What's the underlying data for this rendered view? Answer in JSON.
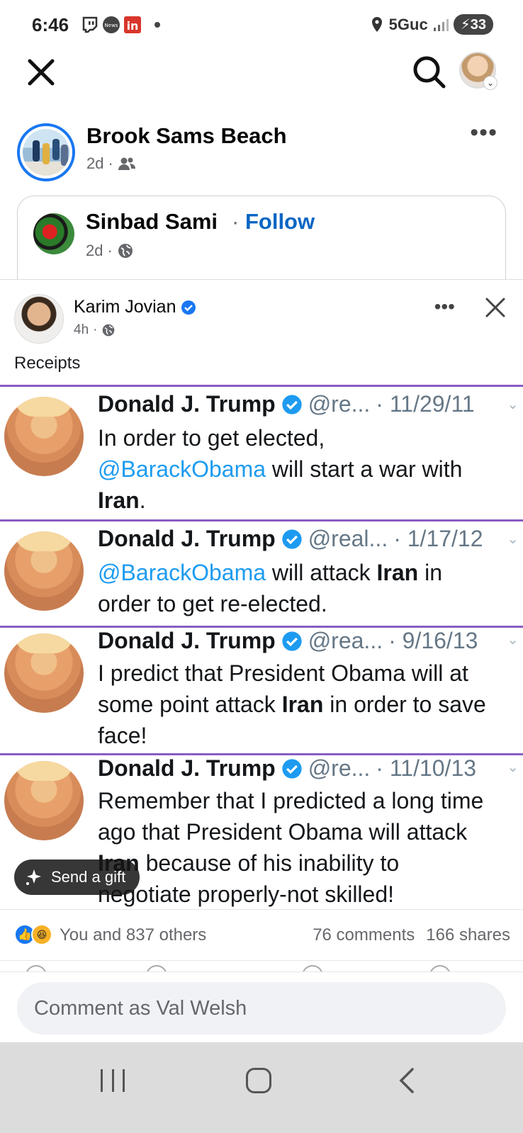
{
  "status_bar": {
    "time": "6:46",
    "network": "5Guc",
    "battery": "33"
  },
  "topbar": {
    "close_icon": "close-icon",
    "search_icon": "search-icon"
  },
  "post": {
    "author": "Brook Sams Beach",
    "time": "2d",
    "audience_separator": "·",
    "more": "•••"
  },
  "shared": {
    "author": "Sinbad Sami",
    "follow_separator": "·",
    "follow_label": "Follow",
    "time": "2d",
    "separator": "·"
  },
  "inner_post": {
    "author": "Karim Jovian",
    "time": "4h",
    "separator": "·",
    "more": "•••",
    "caption": "Receipts"
  },
  "tweets": [
    {
      "name": "Donald J. Trump",
      "handle": "@re...",
      "date": "· 11/29/11",
      "text_plain_1": "In order to get elected,",
      "mention": "@BarackObama",
      "text_plain_2": " will start a war with",
      "bold_word": "Iran",
      "text_plain_3": "."
    },
    {
      "name": "Donald J. Trump",
      "handle": "@real...",
      "date": "· 1/17/12",
      "mention": "@BarackObama",
      "text_plain_1": " will attack ",
      "bold_word": "Iran",
      "text_plain_2": " in",
      "text_plain_3": "order to get re-elected."
    },
    {
      "name": "Donald J. Trump",
      "handle": "@rea...",
      "date": "· 9/16/13",
      "text_plain_1": "I predict that President Obama will at",
      "text_plain_2": "some point attack ",
      "bold_word": "Iran",
      "text_plain_3": " in order to save",
      "text_plain_4": "face!"
    },
    {
      "name": "Donald J. Trump",
      "handle": "@re...",
      "date": "· 11/10/13",
      "text_plain_1": "Remember that I predicted a long time",
      "text_plain_2": "ago that President Obama will attack",
      "bold_word": "Iran",
      "text_plain_3": " because of his inability to",
      "text_plain_4": "negotiate properly-not skilled!"
    }
  ],
  "gift": {
    "label": "Send a gift"
  },
  "reactions": {
    "summary": "You and 837 others",
    "comments": "76 comments",
    "shares": "166 shares"
  },
  "comment": {
    "placeholder": "Comment as Val Welsh"
  },
  "colors": {
    "facebook_blue": "#1877f2",
    "follow_blue": "#0a66c2",
    "mention_blue": "#1d9bf0",
    "divider_purple": "#8a5cc4"
  }
}
